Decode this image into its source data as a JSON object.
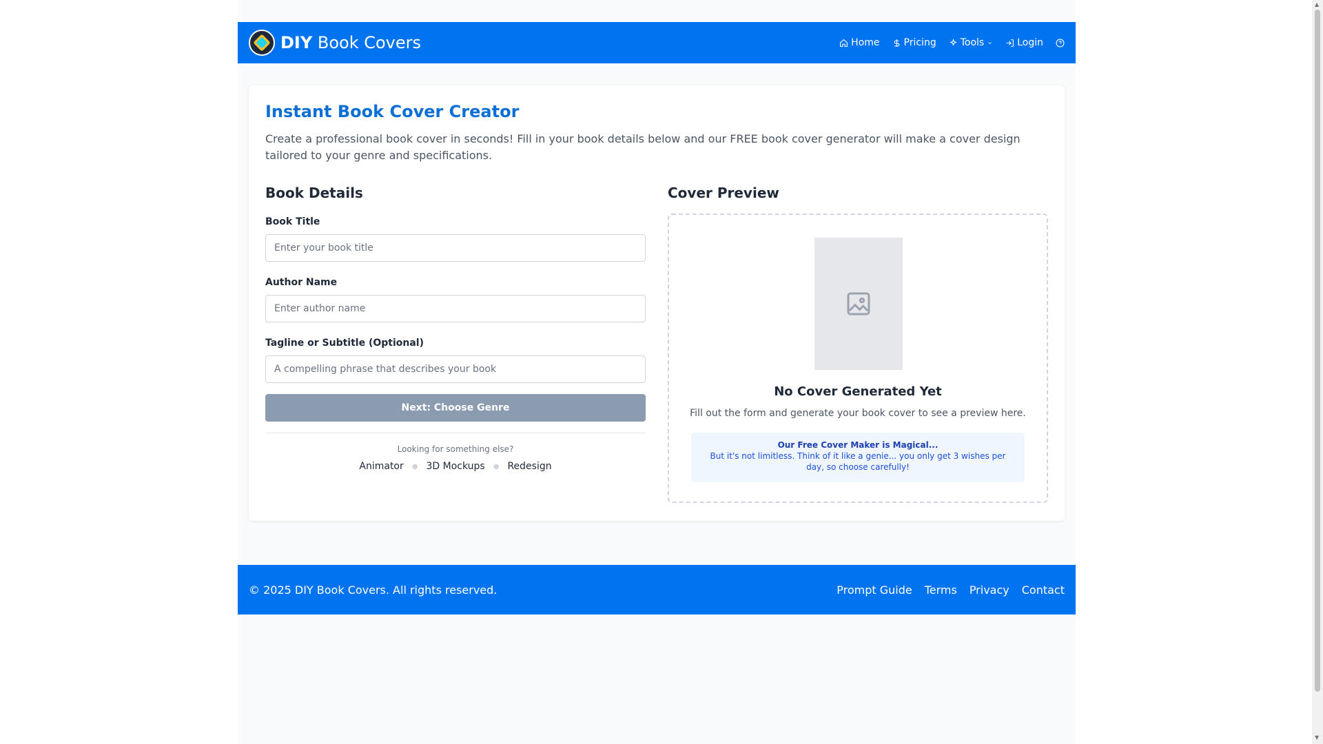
{
  "brand": {
    "bold": "DIY",
    "rest": " Book Covers"
  },
  "nav": {
    "home": "Home",
    "pricing": "Pricing",
    "tools": "Tools",
    "login": "Login"
  },
  "main": {
    "title": "Instant Book Cover Creator",
    "intro": "Create a professional book cover in seconds! Fill in your book details below and our FREE book cover generator will make a cover design tailored to your genre and specifications.",
    "details_heading": "Book Details",
    "fields": {
      "title_label": "Book Title",
      "title_placeholder": "Enter your book title",
      "author_label": "Author Name",
      "author_placeholder": "Enter author name",
      "tagline_label": "Tagline or Subtitle (Optional)",
      "tagline_placeholder": "A compelling phrase that describes your book"
    },
    "next_button": "Next: Choose Genre",
    "alt_question": "Looking for something else?",
    "alt_links": [
      "Animator",
      "3D Mockups",
      "Redesign"
    ],
    "preview_heading": "Cover Preview",
    "no_cover_title": "No Cover Generated Yet",
    "no_cover_sub": "Fill out the form and generate your book cover to see a preview here.",
    "notice_title": "Our Free Cover Maker is Magical...",
    "notice_body": "But it's not limitless. Think of it like a genie... you only get 3 wishes per day, so choose carefully!"
  },
  "footer": {
    "copyright": "© 2025 DIY Book Covers. All rights reserved.",
    "links": [
      "Prompt Guide",
      "Terms",
      "Privacy",
      "Contact"
    ]
  },
  "colors": {
    "brand_blue": "#0074f0",
    "title_blue": "#0b6fd6",
    "disabled_button": "#8b9bb0"
  }
}
